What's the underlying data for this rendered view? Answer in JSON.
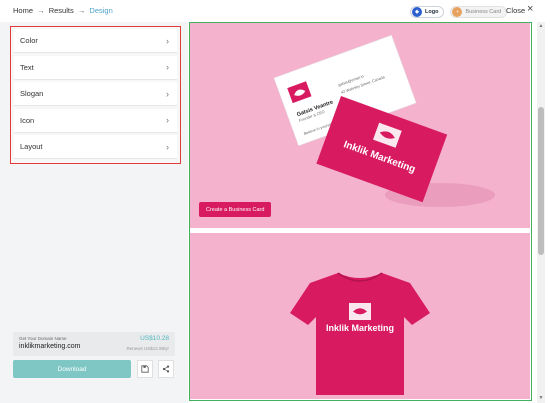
{
  "breadcrumb": {
    "home": "Home",
    "results": "Results",
    "current": "Design",
    "separator": "→"
  },
  "mode_toggle": {
    "logo_label": "Logo",
    "card_label": "Business Card"
  },
  "header": {
    "close_label": "Close",
    "close_icon": "×"
  },
  "menu": {
    "items": [
      {
        "label": "Color"
      },
      {
        "label": "Text"
      },
      {
        "label": "Slogan"
      },
      {
        "label": "Icon"
      },
      {
        "label": "Layout"
      }
    ]
  },
  "domain": {
    "title": "Get Your Domain Name",
    "name": "inklikmarketing.com",
    "price": "US$10.28",
    "renewal": "Renews US$12.98/yr"
  },
  "actions": {
    "download_label": "Download"
  },
  "preview": {
    "create_card_label": "Create a Business Card",
    "brand_name": "Inklik Marketing",
    "card_person_name": "Gatsis Veantre",
    "card_person_title": "Founder & CEO",
    "card_email": "gatsis@email.io",
    "card_address": "42 Walesby Street, Canada",
    "card_tagline": "Believe in yourself"
  },
  "colors": {
    "accent": "#d81b60",
    "background_pink": "#f4b2cd",
    "teal": "#7ec7c5",
    "frame_green": "#42b05f"
  }
}
